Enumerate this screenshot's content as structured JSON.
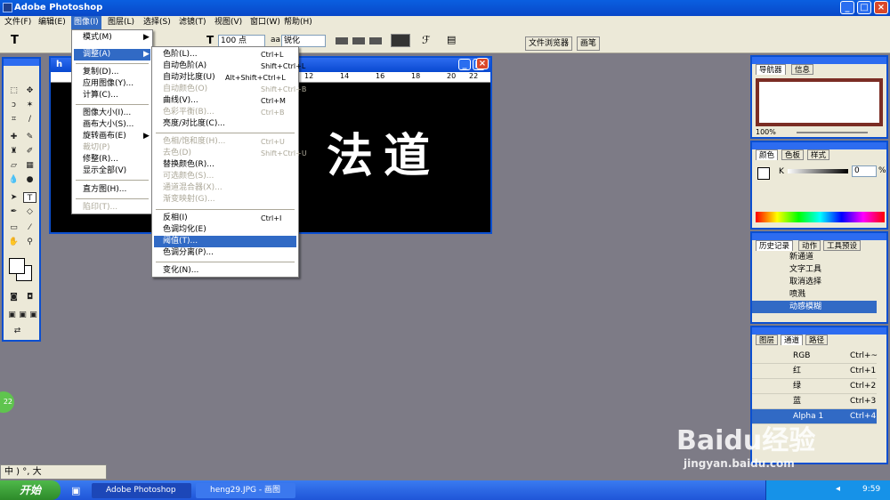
{
  "app": {
    "title": "Adobe Photoshop"
  },
  "menubar": [
    {
      "label": "文件(F)"
    },
    {
      "label": "编辑(E)"
    },
    {
      "label": "图像(I)"
    },
    {
      "label": "图层(L)"
    },
    {
      "label": "选择(S)"
    },
    {
      "label": "滤镜(T)"
    },
    {
      "label": "视图(V)"
    },
    {
      "label": "窗口(W)"
    },
    {
      "label": "帮助(H)"
    }
  ],
  "options": {
    "tool": "T",
    "size": "100 点",
    "aa_label": "aa",
    "aa_mode": "锐化",
    "tab1": "文件浏览器",
    "tab2": "画笔"
  },
  "image_menu": [
    {
      "label": "模式(M)",
      "arrow": "▶"
    },
    {
      "label": "调整(A)",
      "arrow": "▶"
    },
    {
      "label": "复制(D)..."
    },
    {
      "label": "应用图像(Y)..."
    },
    {
      "label": "计算(C)..."
    },
    {
      "label": "图像大小(I)..."
    },
    {
      "label": "画布大小(S)..."
    },
    {
      "label": "旋转画布(E)",
      "arrow": "▶"
    },
    {
      "label": "裁切(P)"
    },
    {
      "label": "修整(R)..."
    },
    {
      "label": "显示全部(V)"
    },
    {
      "label": "直方图(H)..."
    },
    {
      "label": "陷印(T)..."
    }
  ],
  "adjust_menu": [
    {
      "label": "色阶(L)...",
      "sc": "Ctrl+L"
    },
    {
      "label": "自动色阶(A)",
      "sc": "Shift+Ctrl+L"
    },
    {
      "label": "自动对比度(U)",
      "sc": "Alt+Shift+Ctrl+L"
    },
    {
      "label": "自动颜色(O)",
      "sc": "Shift+Ctrl+B"
    },
    {
      "label": "曲线(V)...",
      "sc": "Ctrl+M"
    },
    {
      "label": "色彩平衡(B)...",
      "sc": "Ctrl+B"
    },
    {
      "label": "亮度/对比度(C)...",
      "sc": ""
    },
    {
      "label": "色相/饱和度(H)...",
      "sc": "Ctrl+U"
    },
    {
      "label": "去色(D)",
      "sc": "Shift+Ctrl+U"
    },
    {
      "label": "替换颜色(R)...",
      "sc": ""
    },
    {
      "label": "可选颜色(S)...",
      "sc": ""
    },
    {
      "label": "通道混合器(X)...",
      "sc": ""
    },
    {
      "label": "渐变映射(G)...",
      "sc": ""
    },
    {
      "label": "反相(I)",
      "sc": "Ctrl+I"
    },
    {
      "label": "色调均化(E)",
      "sc": ""
    },
    {
      "label": "阈值(T)...",
      "sc": ""
    },
    {
      "label": "色调分离(P)...",
      "sc": ""
    },
    {
      "label": "变化(N)...",
      "sc": ""
    }
  ],
  "document": {
    "title": "h",
    "text": "法道",
    "ruler": [
      "12",
      "14",
      "16",
      "18",
      "20",
      "22"
    ]
  },
  "navigator": {
    "tabs": [
      "导航器",
      "信息"
    ],
    "zoom": "100%"
  },
  "color": {
    "tabs": [
      "颜色",
      "色板",
      "样式"
    ],
    "k_label": "K",
    "k_value": "0",
    "unit": "%"
  },
  "history": {
    "tabs": [
      "历史记录",
      "动作",
      "工具预设"
    ],
    "items": [
      "新通道",
      "文字工具",
      "取消选择",
      "喷溅",
      "动感模糊"
    ]
  },
  "channels": {
    "tabs": [
      "图层",
      "通道",
      "路径"
    ],
    "rows": [
      {
        "name": "RGB",
        "sc": "Ctrl+~"
      },
      {
        "name": "红",
        "sc": "Ctrl+1"
      },
      {
        "name": "绿",
        "sc": "Ctrl+2"
      },
      {
        "name": "蓝",
        "sc": "Ctrl+3"
      },
      {
        "name": "Alpha 1",
        "sc": "Ctrl+4"
      }
    ]
  },
  "taskbar": {
    "start": "开始",
    "task1": "Adobe Photoshop",
    "task2": "heng29.JPG - 画图",
    "clock": "9:59"
  },
  "ime": {
    "text": "中 ) °, 大"
  },
  "badge": "22",
  "watermark": {
    "brand": "Baidu经验",
    "url": "jingyan.baidu.com"
  }
}
